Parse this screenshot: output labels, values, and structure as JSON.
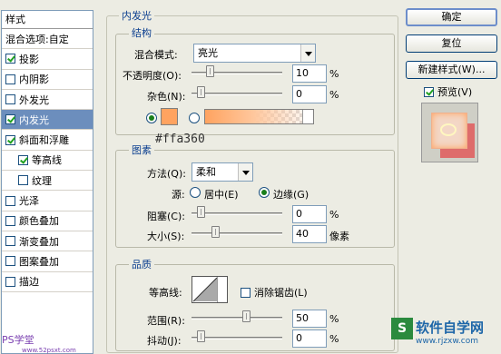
{
  "styles_list": {
    "header": "样式",
    "items": [
      {
        "label": "混合选项:自定",
        "checkbox": false,
        "checked": false,
        "indent": false,
        "selected": false
      },
      {
        "label": "投影",
        "checkbox": true,
        "checked": true,
        "indent": false,
        "selected": false
      },
      {
        "label": "内阴影",
        "checkbox": true,
        "checked": false,
        "indent": false,
        "selected": false
      },
      {
        "label": "外发光",
        "checkbox": true,
        "checked": false,
        "indent": false,
        "selected": false
      },
      {
        "label": "内发光",
        "checkbox": true,
        "checked": true,
        "indent": false,
        "selected": true
      },
      {
        "label": "斜面和浮雕",
        "checkbox": true,
        "checked": true,
        "indent": false,
        "selected": false
      },
      {
        "label": "等高线",
        "checkbox": true,
        "checked": true,
        "indent": true,
        "selected": false
      },
      {
        "label": "纹理",
        "checkbox": true,
        "checked": false,
        "indent": true,
        "selected": false
      },
      {
        "label": "光泽",
        "checkbox": true,
        "checked": false,
        "indent": false,
        "selected": false
      },
      {
        "label": "颜色叠加",
        "checkbox": true,
        "checked": false,
        "indent": false,
        "selected": false
      },
      {
        "label": "渐变叠加",
        "checkbox": true,
        "checked": false,
        "indent": false,
        "selected": false
      },
      {
        "label": "图案叠加",
        "checkbox": true,
        "checked": false,
        "indent": false,
        "selected": false
      },
      {
        "label": "描边",
        "checkbox": true,
        "checked": false,
        "indent": false,
        "selected": false
      }
    ]
  },
  "inner_glow": {
    "title": "内发光",
    "structure": {
      "title": "结构",
      "blend_mode_label": "混合模式:",
      "blend_mode_value": "亮光",
      "opacity_label": "不透明度(O):",
      "opacity_value": "10",
      "opacity_unit": "%",
      "opacity_fraction": 0.1,
      "noise_label": "杂色(N):",
      "noise_value": "0",
      "noise_unit": "%",
      "noise_fraction": 0.0,
      "color_swatch": "#ffa360",
      "hex_annotation": "#ffa360"
    },
    "elements": {
      "title": "图素",
      "technique_label": "方法(Q):",
      "technique_value": "柔和",
      "source_label": "源:",
      "source_center": "居中(E)",
      "source_edge": "边缘(G)",
      "choke_label": "阻塞(C):",
      "choke_value": "0",
      "choke_unit": "%",
      "choke_fraction": 0.0,
      "size_label": "大小(S):",
      "size_value": "40",
      "size_unit": "像素",
      "size_fraction": 0.16
    },
    "quality": {
      "title": "品质",
      "contour_label": "等高线:",
      "anti_alias_label": "消除锯齿(L)",
      "range_label": "范围(R):",
      "range_value": "50",
      "range_unit": "%",
      "range_fraction": 0.5,
      "jitter_label": "抖动(J):",
      "jitter_value": "0",
      "jitter_unit": "%",
      "jitter_fraction": 0.0
    }
  },
  "buttons": {
    "ok": "确定",
    "reset": "复位",
    "new_style": "新建样式(W)...",
    "preview_label": "预览(V)"
  },
  "watermark": {
    "left": "PS学堂",
    "left_url": "www.52psxt.com",
    "right": "软件自学网",
    "right_url": "www.rjzxw.com"
  }
}
